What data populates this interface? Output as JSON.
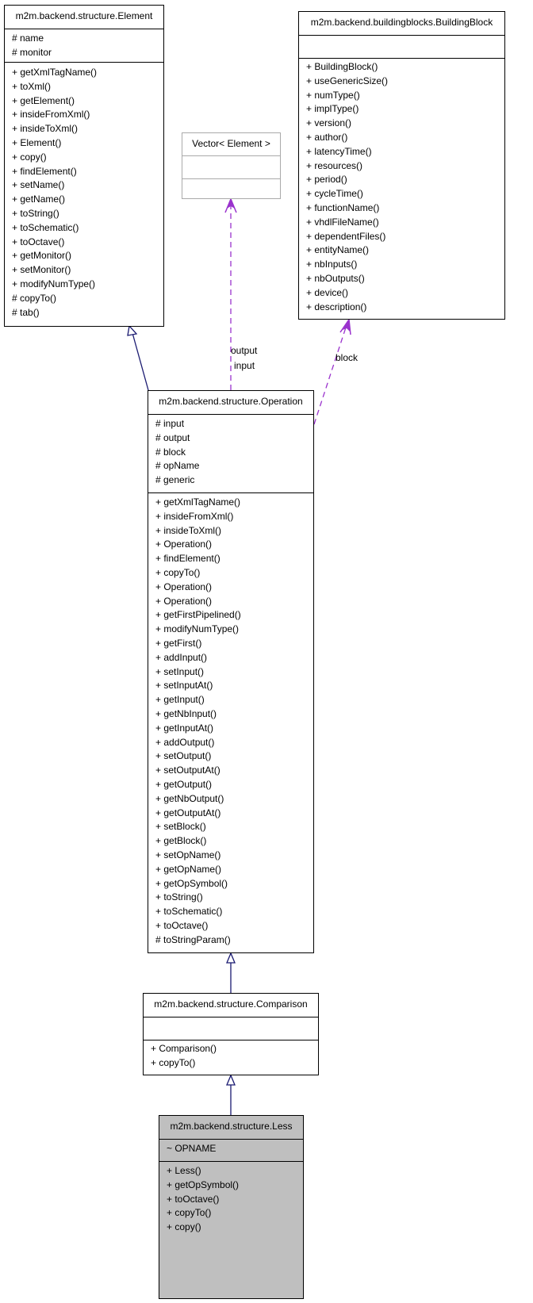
{
  "classes": {
    "element": {
      "name": "m2m.backend.structure.Element",
      "attributes": [
        "# name",
        "# monitor"
      ],
      "methods": [
        "+ getXmlTagName()",
        "+ toXml()",
        "+ getElement()",
        "+ insideFromXml()",
        "+ insideToXml()",
        "+ Element()",
        "+ copy()",
        "+ findElement()",
        "+ setName()",
        "+ getName()",
        "+ toString()",
        "+ toSchematic()",
        "+ toOctave()",
        "+ getMonitor()",
        "+ setMonitor()",
        "+ modifyNumType()",
        "# copyTo()",
        "# tab()"
      ]
    },
    "vector": {
      "name": "Vector< Element >",
      "attributes": [],
      "methods": []
    },
    "building_block": {
      "name": "m2m.backend.buildingblocks.BuildingBlock",
      "attributes": [],
      "methods": [
        "+ BuildingBlock()",
        "+ useGenericSize()",
        "+ numType()",
        "+ implType()",
        "+ version()",
        "+ author()",
        "+ latencyTime()",
        "+ resources()",
        "+ period()",
        "+ cycleTime()",
        "+ functionName()",
        "+ vhdlFileName()",
        "+ dependentFiles()",
        "+ entityName()",
        "+ nbInputs()",
        "+ nbOutputs()",
        "+ device()",
        "+ description()"
      ]
    },
    "operation": {
      "name": "m2m.backend.structure.Operation",
      "attributes": [
        "# input",
        "# output",
        "# block",
        "# opName",
        "# generic"
      ],
      "methods": [
        "+ getXmlTagName()",
        "+ insideFromXml()",
        "+ insideToXml()",
        "+ Operation()",
        "+ findElement()",
        "+ copyTo()",
        "+ Operation()",
        "+ Operation()",
        "+ getFirstPipelined()",
        "+ modifyNumType()",
        "+ getFirst()",
        "+ addInput()",
        "+ setInput()",
        "+ setInputAt()",
        "+ getInput()",
        "+ getNbInput()",
        "+ getInputAt()",
        "+ addOutput()",
        "+ setOutput()",
        "+ setOutputAt()",
        "+ getOutput()",
        "+ getNbOutput()",
        "+ getOutputAt()",
        "+ setBlock()",
        "+ getBlock()",
        "+ setOpName()",
        "+ getOpName()",
        "+ getOpSymbol()",
        "+ toString()",
        "+ toSchematic()",
        "+ toOctave()",
        "# toStringParam()"
      ]
    },
    "comparison": {
      "name": "m2m.backend.structure.Comparison",
      "attributes": [],
      "methods": [
        "+ Comparison()",
        "+ copyTo()"
      ]
    },
    "less": {
      "name": "m2m.backend.structure.Less",
      "attributes": [
        "~ OPNAME"
      ],
      "methods": [
        "+ Less()",
        "+ getOpSymbol()",
        "+ toOctave()",
        "+ copyTo()",
        "+ copy()"
      ]
    }
  },
  "edge_labels": {
    "vector_output": "output",
    "vector_input": "input",
    "block": "block"
  },
  "colors": {
    "inheritance": "#191970",
    "association": "#9a32cd",
    "highlight_fill": "#bfbfbf",
    "template_border": "#aaaaaa"
  }
}
